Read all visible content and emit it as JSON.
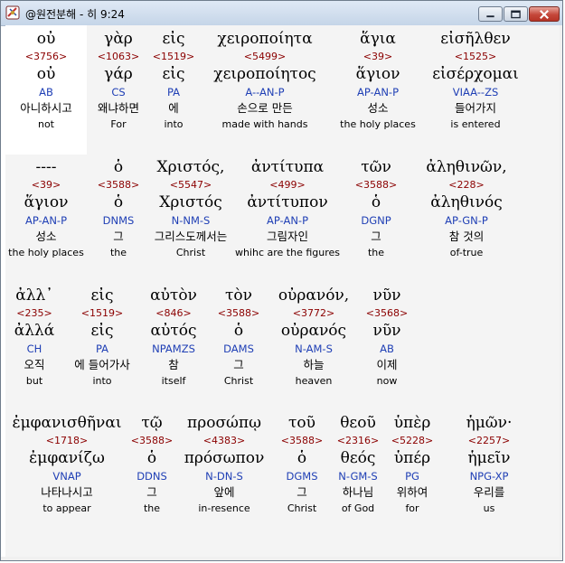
{
  "window": {
    "title": "@원전분해 - 히 9:24"
  },
  "rows": [
    [
      {
        "greek": "οὐ",
        "num": "<3756>",
        "lemma": "οὐ",
        "parse": "AB",
        "korean": "아니하시고",
        "english": "not"
      },
      {
        "greek": "γὰρ",
        "num": "<1063>",
        "lemma": "γάρ",
        "parse": "CS",
        "korean": "왜냐하면",
        "english": "For"
      },
      {
        "greek": "εἰς",
        "num": "<1519>",
        "lemma": "εἰς",
        "parse": "PA",
        "korean": "에",
        "english": "into"
      },
      {
        "greek": "χειροποίητα",
        "num": "<5499>",
        "lemma": "χειροποίητος",
        "parse": "A--AN-P",
        "korean": "손으로 만든",
        "english": "made with hands"
      },
      {
        "greek": "ἅγια",
        "num": "<39>",
        "lemma": "ἅγιον",
        "parse": "AP-AN-P",
        "korean": "성소",
        "english": "the holy places"
      },
      {
        "greek": "εἰσῆλθεν",
        "num": "<1525>",
        "lemma": "εἰσέρχομαι",
        "parse": "VIAA--ZS",
        "korean": "들어가지",
        "english": "is entered"
      }
    ],
    [
      {
        "greek": "----",
        "num": "<39>",
        "lemma": "ἅγιον",
        "parse": "AP-AN-P",
        "korean": "성소",
        "english": "the holy places"
      },
      {
        "greek": "ὁ",
        "num": "<3588>",
        "lemma": "ὁ",
        "parse": "DNMS",
        "korean": "그",
        "english": "the"
      },
      {
        "greek": "Χριστός,",
        "num": "<5547>",
        "lemma": "Χριστός",
        "parse": "N-NM-S",
        "korean": "그리스도께서는",
        "english": "Christ"
      },
      {
        "greek": "ἀντίτυπα",
        "num": "<499>",
        "lemma": "ἀντίτυπον",
        "parse": "AP-AN-P",
        "korean": "그림자인",
        "english": "whihc are the figures"
      },
      {
        "greek": "τῶν",
        "num": "<3588>",
        "lemma": "ὁ",
        "parse": "DGNP",
        "korean": "그",
        "english": "the"
      },
      {
        "greek": "ἀληθινῶν,",
        "num": "<228>",
        "lemma": "ἀληθινός",
        "parse": "AP-GN-P",
        "korean": "참 것의",
        "english": "of-true"
      }
    ],
    [
      {
        "greek": "ἀλλ᾽",
        "num": "<235>",
        "lemma": "ἀλλά",
        "parse": "CH",
        "korean": "오직",
        "english": "but"
      },
      {
        "greek": "εἰς",
        "num": "<1519>",
        "lemma": "εἰς",
        "parse": "PA",
        "korean": "에 들어가사",
        "english": "into"
      },
      {
        "greek": "αὐτὸν",
        "num": "<846>",
        "lemma": "αὐτός",
        "parse": "NPAMZS",
        "korean": "참",
        "english": "itself"
      },
      {
        "greek": "τὸν",
        "num": "<3588>",
        "lemma": "ὁ",
        "parse": "DAMS",
        "korean": "그",
        "english": "Christ"
      },
      {
        "greek": "οὐρανόν,",
        "num": "<3772>",
        "lemma": "οὐρανός",
        "parse": "N-AM-S",
        "korean": "하늘",
        "english": "heaven"
      },
      {
        "greek": "νῦν",
        "num": "<3568>",
        "lemma": "νῦν",
        "parse": "AB",
        "korean": "이제",
        "english": "now"
      }
    ],
    [
      {
        "greek": "ἐμφανισθῆναι",
        "num": "<1718>",
        "lemma": "ἐμφανίζω",
        "parse": "VNAP",
        "korean": "나타나시고",
        "english": "to appear"
      },
      {
        "greek": "τῷ",
        "num": "<3588>",
        "lemma": "ὁ",
        "parse": "DDNS",
        "korean": "그",
        "english": "the"
      },
      {
        "greek": "προσώπῳ",
        "num": "<4383>",
        "lemma": "πρόσωπον",
        "parse": "N-DN-S",
        "korean": "앞에",
        "english": "in-resence"
      },
      {
        "greek": "τοῦ",
        "num": "<3588>",
        "lemma": "ὁ",
        "parse": "DGMS",
        "korean": "그",
        "english": "Christ"
      },
      {
        "greek": "θεοῦ",
        "num": "<2316>",
        "lemma": "θεός",
        "parse": "N-GM-S",
        "korean": "하나님",
        "english": "of God"
      },
      {
        "greek": "ὑπὲρ",
        "num": "<5228>",
        "lemma": "ὑπέρ",
        "parse": "PG",
        "korean": "위하여",
        "english": "for"
      },
      {
        "greek": "ἡμῶν·",
        "num": "<2257>",
        "lemma": "ἡμεῖν",
        "parse": "NPG-XP",
        "korean": "우리를",
        "english": "us"
      }
    ]
  ]
}
